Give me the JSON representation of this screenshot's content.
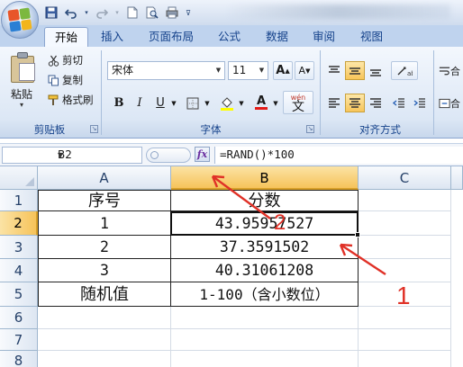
{
  "ribbon_tabs": [
    "开始",
    "插入",
    "页面布局",
    "公式",
    "数据",
    "审阅",
    "视图"
  ],
  "active_tab": "开始",
  "clipboard": {
    "paste": "粘贴",
    "cut": "剪切",
    "copy": "复制",
    "format_painter": "格式刷",
    "group_label": "剪贴板"
  },
  "font": {
    "name": "宋体",
    "size": "11",
    "bold": "B",
    "italic": "I",
    "underline": "U",
    "group_label": "字体",
    "phonetic": "wén"
  },
  "alignment": {
    "group_label": "对齐方式"
  },
  "formula_bar": {
    "name_box": "B2",
    "fx": "fx",
    "formula": "=RAND()*100"
  },
  "sheet": {
    "columns": [
      "A",
      "B",
      "C"
    ],
    "rows": [
      "1",
      "2",
      "3",
      "4",
      "5",
      "6",
      "7",
      "8"
    ],
    "cells": [
      [
        "序号",
        "分数",
        ""
      ],
      [
        "1",
        "43.95957527",
        ""
      ],
      [
        "2",
        "37.3591502",
        ""
      ],
      [
        "3",
        "40.31061208",
        ""
      ],
      [
        "随机值",
        "1-100（含小数位）",
        ""
      ]
    ],
    "selected_cell": "B2"
  },
  "annotations": {
    "label_1": "1",
    "label_2": "2"
  },
  "colors": {
    "accent_red": "#e03127",
    "ribbon_text": "#15428b",
    "selection": "#f6c35a"
  },
  "icons": [
    "office-button-icon",
    "save-icon",
    "undo-icon",
    "redo-icon",
    "new-doc-icon",
    "print-preview-icon",
    "quick-print-icon",
    "qat-customize-icon",
    "cut-icon",
    "copy-icon",
    "format-painter-icon",
    "grow-font-icon",
    "shrink-font-icon",
    "border-icon",
    "fill-color-icon",
    "font-color-icon",
    "align-top-icon",
    "align-middle-icon",
    "align-bottom-icon",
    "orientation-icon",
    "align-left-icon",
    "align-center-icon",
    "align-right-icon",
    "decrease-indent-icon",
    "increase-indent-icon",
    "wrap-text-icon",
    "fx-icon"
  ]
}
